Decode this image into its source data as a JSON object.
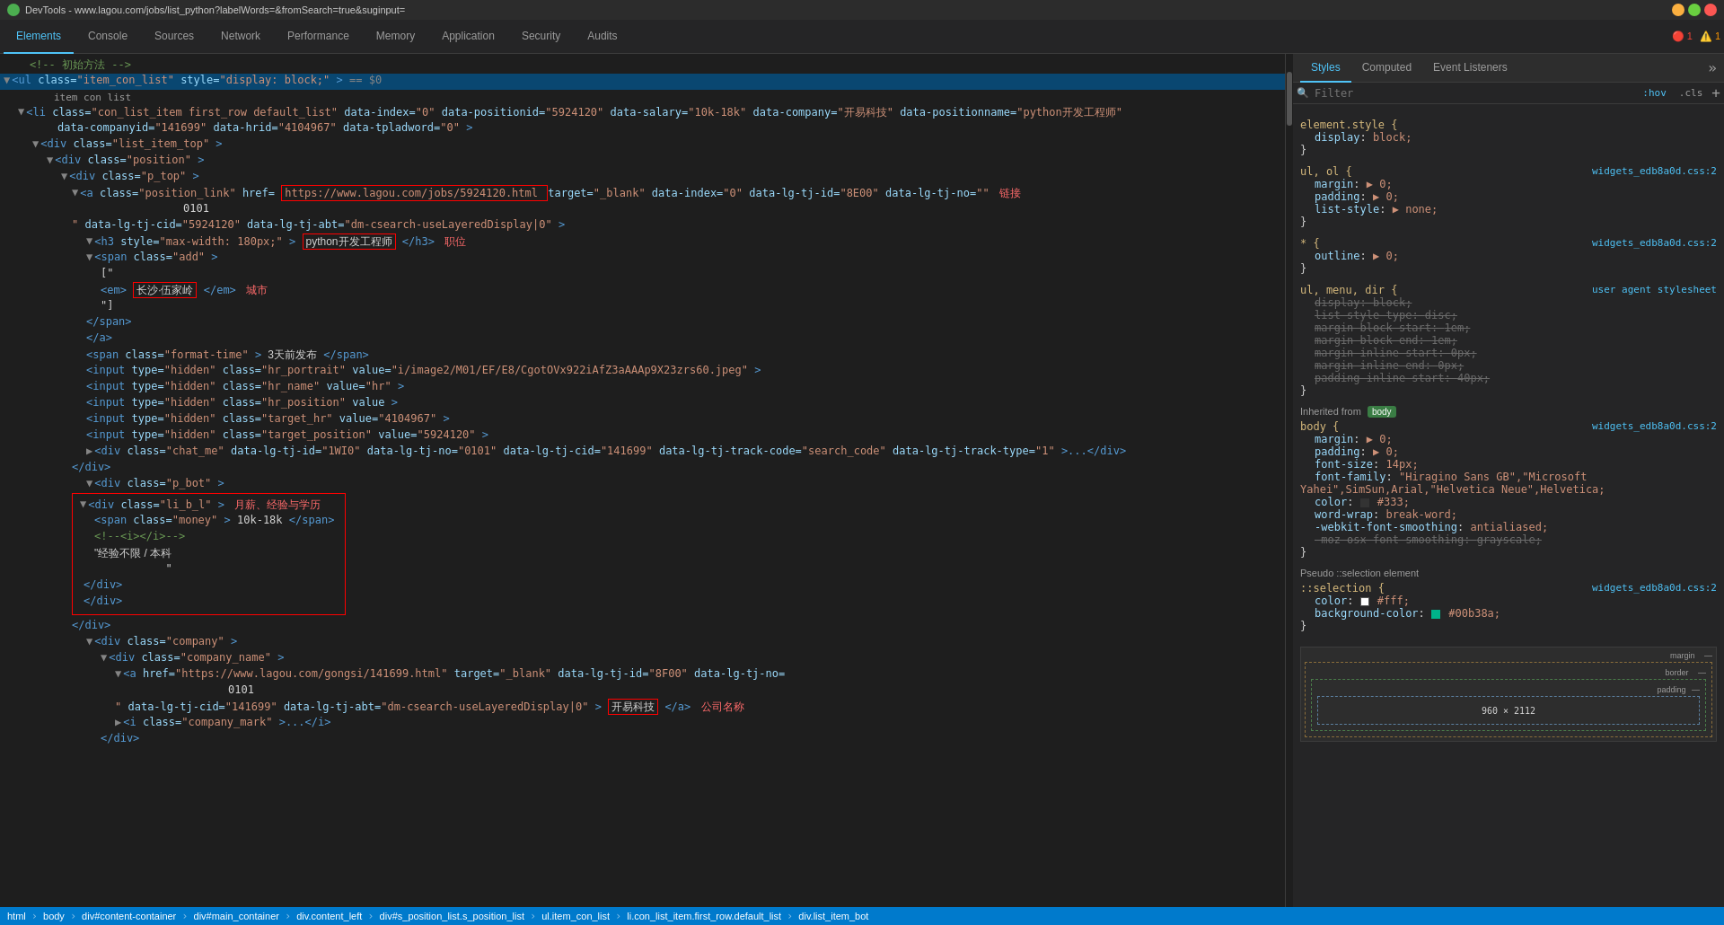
{
  "titlebar": {
    "title": "DevTools - www.lagou.com/jobs/list_python?labelWords=&fromSearch=true&suginput=",
    "favicon_color": "#4caf50"
  },
  "tabs": [
    {
      "id": "elements",
      "label": "Elements",
      "active": true
    },
    {
      "id": "console",
      "label": "Console",
      "active": false
    },
    {
      "id": "sources",
      "label": "Sources",
      "active": false
    },
    {
      "id": "network",
      "label": "Network",
      "active": false
    },
    {
      "id": "performance",
      "label": "Performance",
      "active": false
    },
    {
      "id": "memory",
      "label": "Memory",
      "active": false
    },
    {
      "id": "application",
      "label": "Application",
      "active": false
    },
    {
      "id": "security",
      "label": "Security",
      "active": false
    },
    {
      "id": "audits",
      "label": "Audits",
      "active": false
    }
  ],
  "right_tabs": [
    {
      "id": "styles",
      "label": "Styles",
      "active": true
    },
    {
      "id": "computed",
      "label": "Computed",
      "active": false
    },
    {
      "id": "event_listeners",
      "label": "Event Listeners",
      "active": false
    }
  ],
  "filter": {
    "placeholder": "Filter",
    "hov_label": ":hov",
    "cls_label": ".cls",
    "add_label": "+"
  },
  "alerts": {
    "error_count": "1",
    "warning_count": "1"
  },
  "html_content": {
    "comment_line": "<!-- 初始方法 -->",
    "ul_line": "<ul class=\"item_con_list\" style=\"display: block;\"> == $0",
    "item_con_list_label": "item con list",
    "li_open": "<li class=\"con_list_item first_row default_list\"",
    "li_attrs": " data-index=\"0\" data-positionid=\"5924120\" data-salary=\"10k-18k\" data-company=\"开易科技\" data-positionname=\"python开发工程师\" data-companyid=\"141699\" data-hrid=\"4104967\" data-tpladword=\"0\">",
    "div_list_item_top": "<div class=\"list_item_top\">",
    "div_position": "<div class=\"position\">",
    "div_p_top": "<div class=\"p_top\">",
    "a_position_link": "<a class=\"position_link\" href=",
    "href_val": "https://www.lagou.com/jobs/5924120.html",
    "a_attrs": " target=\"_blank\" data-index=\"0\" data-lg-tj-id=\"8E00\" data-lg-tj-no=",
    "label_link": "链接",
    "data_line": "\" data-lg-tj-cid=\"5924120\" data-lg-tj-abt=\"dm-csearch-useLayeredDisplay|0\">",
    "h3_open": "<h3 style=\"max-width: 180px;\">",
    "h3_text": "python开发工程师",
    "h3_close": "</h3>",
    "label_position": "职位",
    "span_add": "<span class=\"add\">",
    "bracket_open": "[\"",
    "em_open": "<em>",
    "city_text": "长沙·伍家岭",
    "em_close": "</em>",
    "label_city": "城市",
    "bracket_close": "\"]",
    "span_close": "</span>",
    "a_close": "</a>",
    "format_time": "<span class=\"format-time\">3天前发布</span>",
    "input_hr_portrait": "<input type=\"hidden\" class=\"hr_portrait\" value=\"i/image2/M01/EF/E8/CgotOVx922iAfZ3aAAAp9X23zrs60.jpeg\">",
    "input_hr_name": "<input type=\"hidden\" class=\"hr_name\" value=\"hr\">",
    "input_hr_position": "<input type=\"hidden\" class=\"hr_position\" value>",
    "input_target_hr": "<input type=\"hidden\" class=\"target_hr\" value=\"4104967\">",
    "input_target_position": "<input type=\"hidden\" class=\"target_position\" value=\"5924120\">",
    "div_chat_me": "<div class=\"chat_me\" data-lg-tj-id=\"1WI0\" data-lg-tj-no=\"0101\" data-lg-tj-cid=\"141699\" data-lg-tj-track-code=\"search_code\" data-lg-tj-track-type=\"1\">...</div>",
    "div_close": "</div>",
    "div_p_bot": "<div class=\"p_bot\">",
    "div_li_b_l": "<div class=\"li_b_l\">",
    "label_salary": "月薪、经验与学历",
    "span_money": "<span class=\"money\">10k-18k</span>",
    "comment_i": "<!--<i></i>-->",
    "exp_text": "\"经验不限 / 本科",
    "exp_space": "           \"",
    "div_close2": "</div>",
    "div_close3": "</div>",
    "div_close4": "</div>",
    "div_company": "<div class=\"company\">",
    "div_company_name": "<div class=\"company_name\">",
    "a_company": "<a href=\"https://www.lagou.com/gongsi/141699.html\" target=\"_blank\" data-lg-tj-id=\"8F00\" data-lg-tj-no=",
    "line_0101": "0101",
    "data_company_line": "\" data-lg-tj-cid=\"141699\" data-lg-tj-abt=\"dm-csearch-useLayeredDisplay|0\">",
    "company_name_text": "开易科技",
    "a_close2": "</a>",
    "label_company": "公司名称",
    "i_company_mark": "<i class=\"company_mark\">...</i>"
  },
  "css_blocks": [
    {
      "selector": "element.style {",
      "source": "",
      "properties": [
        {
          "name": "display",
          "value": "block;",
          "strikethrough": false
        }
      ]
    },
    {
      "selector": "ul, ol {",
      "source": "widgets_edb8a0d.css:2",
      "properties": [
        {
          "name": "margin",
          "value": "▶ 0;",
          "strikethrough": false
        },
        {
          "name": "padding",
          "value": "▶ 0;",
          "strikethrough": false
        },
        {
          "name": "list-style",
          "value": "▶ none;",
          "strikethrough": false
        }
      ]
    },
    {
      "selector": "* {",
      "source": "widgets_edb8a0d.css:2",
      "properties": [
        {
          "name": "outline",
          "value": "▶ 0;",
          "strikethrough": false
        }
      ]
    },
    {
      "selector": "ul, menu, dir {",
      "source": "user agent stylesheet",
      "properties": [
        {
          "name": "display",
          "value": "block;",
          "strikethrough": true
        },
        {
          "name": "list-style-type",
          "value": "disc;",
          "strikethrough": true
        },
        {
          "name": "margin-block-start",
          "value": "1em;",
          "strikethrough": true
        },
        {
          "name": "margin-block-end",
          "value": "1em;",
          "strikethrough": true
        },
        {
          "name": "margin-inline-start",
          "value": "0px;",
          "strikethrough": true
        },
        {
          "name": "margin-inline-end",
          "value": "0px;",
          "strikethrough": true
        },
        {
          "name": "padding-inline-start",
          "value": "40px;",
          "strikethrough": true
        }
      ]
    }
  ],
  "inherited_from": "body",
  "body_css": {
    "selector": "body {",
    "source": "widgets_edb8a0d.css:2",
    "properties": [
      {
        "name": "margin",
        "value": "▶ 0;",
        "strikethrough": false
      },
      {
        "name": "padding",
        "value": "▶ 0;",
        "strikethrough": false
      },
      {
        "name": "font-size",
        "value": "14px;",
        "strikethrough": false
      },
      {
        "name": "font-family",
        "value": "\"Hiragino Sans GB\",\"Microsoft Yahei\",SimSun,Arial,\"Helvetica Neue\",Helvetica;",
        "strikethrough": false
      },
      {
        "name": "color",
        "value": "■ #333;",
        "strikethrough": false
      },
      {
        "name": "word-wrap",
        "value": "break-word;",
        "strikethrough": false
      },
      {
        "name": "-webkit-font-smoothing",
        "value": "antialiased;",
        "strikethrough": false
      },
      {
        "name": "-moz-osx-font-smoothing",
        "value": "grayscale;",
        "strikethrough": true
      }
    ]
  },
  "pseudo_selection": {
    "label": "Pseudo ::selection element",
    "selector": "::selection {",
    "source": "widgets_edb8a0d.css:2",
    "properties": [
      {
        "name": "color",
        "value": "□ #fff;",
        "strikethrough": false
      },
      {
        "name": "background-color",
        "value": "■ #00b38a;",
        "strikethrough": false
      }
    ]
  },
  "box_model": {
    "margin_label": "margin",
    "border_label": "border",
    "padding_label": "padding",
    "size": "960 × 2112",
    "dash": "—"
  },
  "statusbar": {
    "items": [
      "html",
      "body",
      "div#content-container",
      "div#main_container",
      "div.content_left",
      "div#s_position_list.s_position_list",
      "ul.item_con_list",
      "li.con_list_item.first_row.default_list",
      "div.list_item_bot"
    ]
  }
}
